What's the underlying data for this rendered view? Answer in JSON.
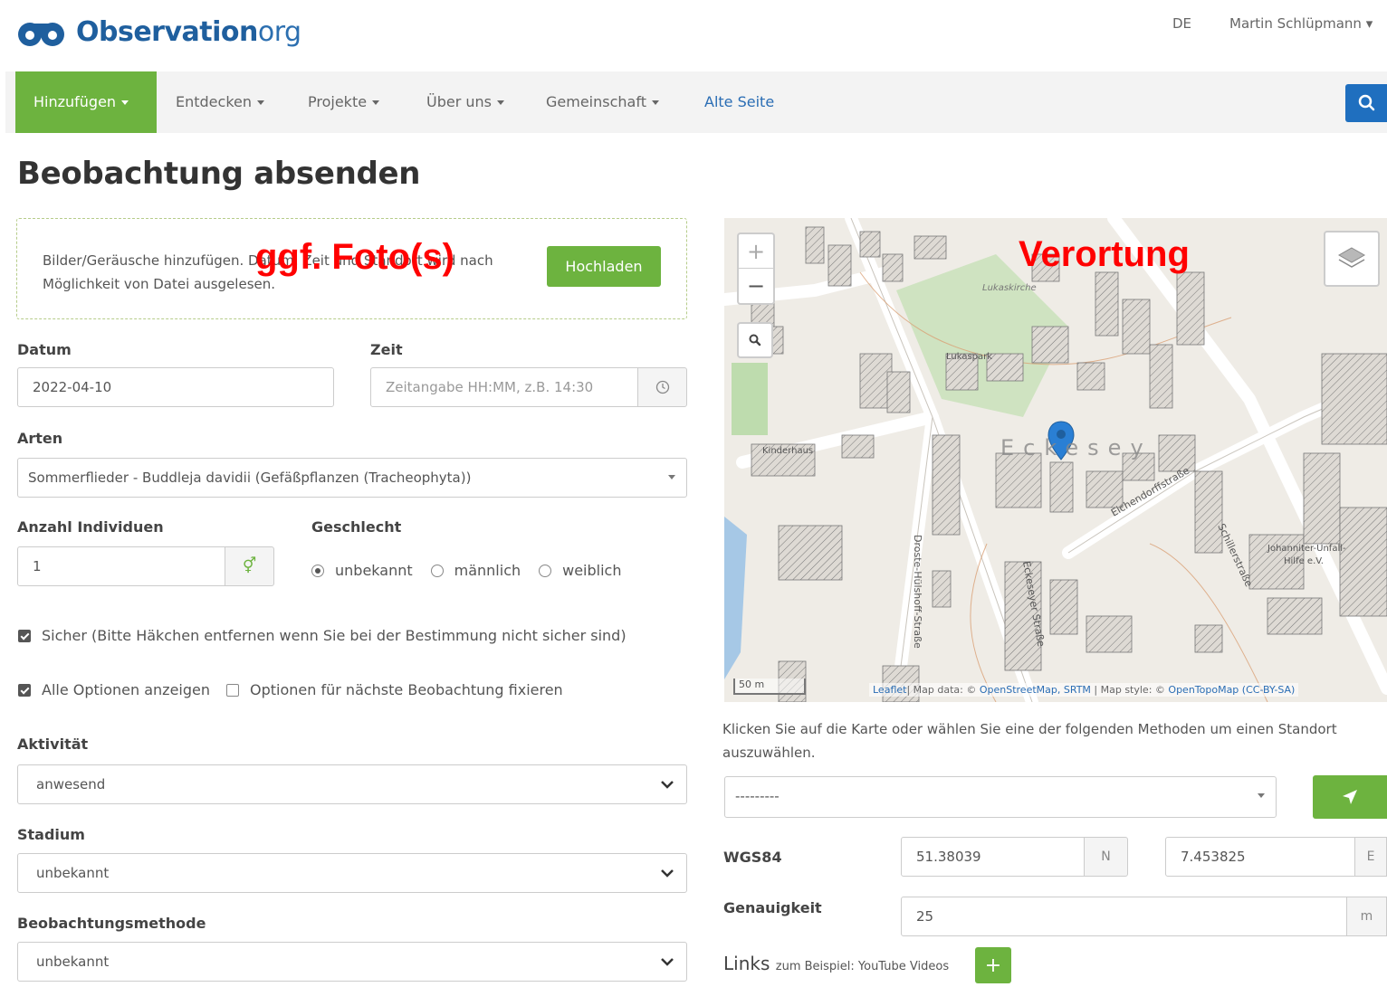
{
  "header": {
    "logo_text_main": "Observation",
    "logo_text_suffix": "org",
    "language": "DE",
    "user": "Martin Schlüpmann"
  },
  "nav": {
    "items": [
      {
        "label": "Hinzufügen"
      },
      {
        "label": "Entdecken"
      },
      {
        "label": "Projekte"
      },
      {
        "label": "Über uns"
      },
      {
        "label": "Gemeinschaft"
      },
      {
        "label": "Alte Seite"
      }
    ]
  },
  "page_title": "Beobachtung absenden",
  "upload": {
    "text": "Bilder/Geräusche hinzufügen. Datum, Zeit und Standort wird nach Möglichkeit von Datei ausgelesen.",
    "button": "Hochladen"
  },
  "annotations": {
    "photo": "ggf. Foto(s)",
    "location": "Verortung"
  },
  "form": {
    "date_label": "Datum",
    "date_value": "2022-04-10",
    "time_label": "Zeit",
    "time_placeholder": "Zeitangabe HH:MM, z.B. 14:30",
    "species_label": "Arten",
    "species_value": "Sommerflieder - Buddleja davidii (Gefäßpflanzen (Tracheophyta))",
    "count_label": "Anzahl Individuen",
    "count_value": "1",
    "sex_label": "Geschlecht",
    "sex_options": [
      "unbekannt",
      "männlich",
      "weiblich"
    ],
    "sure_label": "Sicher (Bitte Häkchen entfernen wenn Sie bei der Bestimmung nicht sicher sind)",
    "all_options_label": "Alle Optionen anzeigen",
    "fix_options_label": "Optionen für nächste Beobachtung fixieren",
    "activity_label": "Aktivität",
    "activity_value": "anwesend",
    "stage_label": "Stadium",
    "stage_value": "unbekannt",
    "method_label": "Beobachtungsmethode",
    "method_value": "unbekannt"
  },
  "map": {
    "scale": "50 m",
    "attrib_leaflet": "Leaflet",
    "attrib_text": "| Map data: © ",
    "attrib_osm": "OpenStreetMap",
    "attrib_srtm": ", SRTM",
    "attrib_style": " | Map style: © ",
    "attrib_otm": "OpenTopoMap (CC-BY-SA)",
    "place_name": "Eckesey",
    "streets": [
      "Eichendorffstraße",
      "Schillerstraße",
      "Eckeseyer Straße",
      "Droste-Hülshoff-Straße"
    ],
    "pois": [
      "Lukaspark",
      "Lukaskirche",
      "Kinderhaus",
      "Johanniter-Unfall-Hilfe e.V."
    ]
  },
  "location": {
    "help": "Klicken Sie auf die Karte oder wählen Sie eine der folgenden Methoden um einen Standort auszuwählen.",
    "method_value": "---------",
    "wgs_label": "WGS84",
    "lat": "51.38039",
    "lat_unit": "N",
    "lon": "7.453825",
    "lon_unit": "E",
    "accuracy_label": "Genauigkeit",
    "accuracy_value": "25",
    "accuracy_unit": "m",
    "links_label": "Links",
    "links_sub": "zum Beispiel: YouTube Videos"
  }
}
